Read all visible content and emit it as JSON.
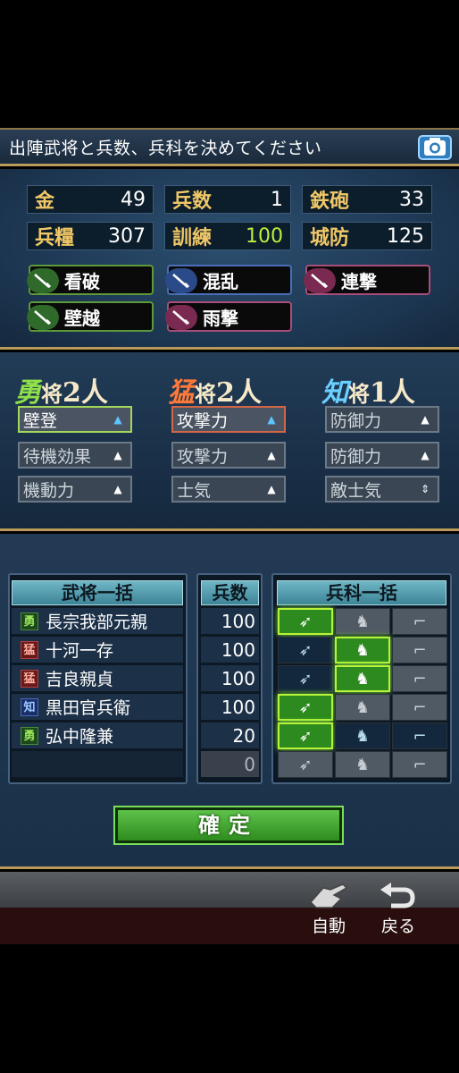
{
  "header": {
    "title": "出陣武将と兵数、兵科を決めてください"
  },
  "stats": [
    {
      "label": "金",
      "value": "49",
      "color": "#ffffff"
    },
    {
      "label": "兵数",
      "value": "1",
      "color": "#ffffff"
    },
    {
      "label": "鉄砲",
      "value": "33",
      "color": "#ffffff"
    },
    {
      "label": "兵糧",
      "value": "307",
      "color": "#ffffff"
    },
    {
      "label": "訓練",
      "value": "100",
      "color": "#b9f23a"
    },
    {
      "label": "城防",
      "value": "125",
      "color": "#ffffff"
    }
  ],
  "skills": [
    {
      "label": "看破",
      "kind": "green"
    },
    {
      "label": "混乱",
      "kind": "blue"
    },
    {
      "label": "連撃",
      "kind": "red"
    },
    {
      "label": "壁越",
      "kind": "green"
    },
    {
      "label": "雨撃",
      "kind": "red"
    }
  ],
  "groups": [
    {
      "kind": "勇",
      "sho": "将",
      "count": "2人",
      "options": [
        "壁登",
        "待機効果",
        "機動力"
      ]
    },
    {
      "kind": "猛",
      "sho": "将",
      "count": "2人",
      "options": [
        "攻撃力",
        "攻撃力",
        "士気"
      ]
    },
    {
      "kind": "知",
      "sho": "将",
      "count": "1人",
      "options": [
        "防御力",
        "防御力",
        "敵士気"
      ]
    }
  ],
  "table": {
    "col_general": "武将一括",
    "col_troops": "兵数",
    "col_type": "兵科一括",
    "rows": [
      {
        "type": "勇",
        "name": "長宗我部元親",
        "troops": "100"
      },
      {
        "type": "猛",
        "name": "十河一存",
        "troops": "100"
      },
      {
        "type": "猛",
        "name": "吉良親貞",
        "troops": "100"
      },
      {
        "type": "知",
        "name": "黒田官兵衛",
        "troops": "100"
      },
      {
        "type": "勇",
        "name": "弘中隆兼",
        "troops": "20"
      },
      {
        "type": "",
        "name": "",
        "troops": "0"
      }
    ],
    "unit_selected": [
      "spear",
      "horse",
      "horse",
      "spear",
      "spear",
      "none"
    ]
  },
  "confirm_label": "確定",
  "footer": {
    "auto_label": "自動",
    "back_label": "戻る"
  }
}
